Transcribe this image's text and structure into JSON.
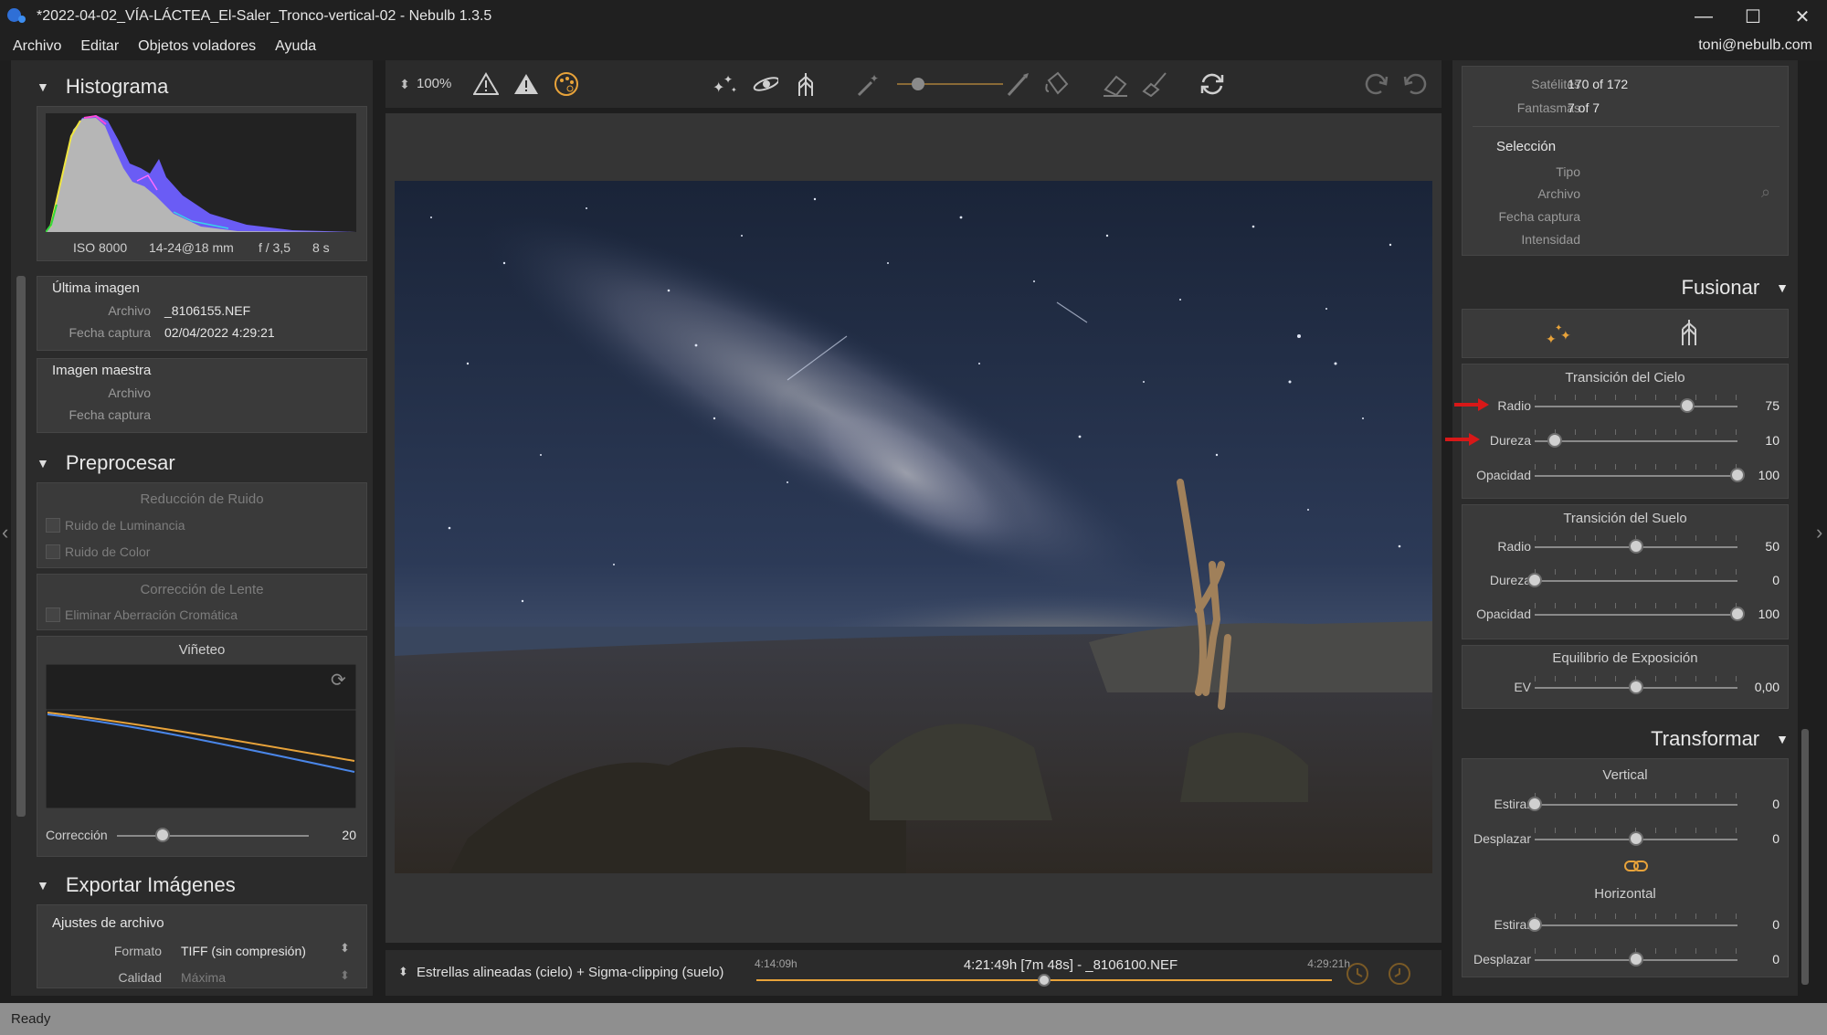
{
  "window": {
    "title": "*2022-04-02_VÍA-LÁCTEA_El-Saler_Tronco-vertical-02 - Nebulb 1.3.5",
    "minimize": "—",
    "maximize": "☐",
    "close": "✕"
  },
  "menu": {
    "items": [
      "Archivo",
      "Editar",
      "Objetos voladores",
      "Ayuda"
    ],
    "user": "toni@nebulb.com"
  },
  "histogram": {
    "title": "Histograma",
    "iso": "ISO 8000",
    "lens": "14-24@18 mm",
    "aperture": "f / 3,5",
    "exposure": "8 s"
  },
  "last_image": {
    "title": "Última imagen",
    "archivo_label": "Archivo",
    "archivo_value": "_8106155.NEF",
    "fecha_label": "Fecha captura",
    "fecha_value": "02/04/2022 4:29:21"
  },
  "master_image": {
    "title": "Imagen maestra",
    "archivo_label": "Archivo",
    "fecha_label": "Fecha captura"
  },
  "preprocess": {
    "title": "Preprocesar",
    "noise_title": "Reducción de Ruido",
    "luminance": "Ruido de Luminancia",
    "color": "Ruido de Color",
    "lens_title": "Corrección de Lente",
    "chromatic": "Eliminar Aberración Cromática",
    "vignette_title": "Viñeteo",
    "correction_label": "Corrección",
    "correction_value": "20",
    "correction_level": 0.24
  },
  "export": {
    "title": "Exportar Imágenes",
    "settings_title": "Ajustes de archivo",
    "format_label": "Formato",
    "format_value": "TIFF (sin compresión)",
    "quality_label": "Calidad",
    "quality_value": "Máxima"
  },
  "toolbar": {
    "zoom": "100%"
  },
  "bottom": {
    "mode": "Estrellas alineadas (cielo) + Sigma-clipping (suelo)",
    "time_start": "4:14:09h",
    "time_current": "4:21:49h [7m 48s] - _8106100.NEF",
    "time_end": "4:29:21h",
    "timeline_position": 0.5
  },
  "stats": {
    "satelites_label": "Satélites",
    "satelites_value": "170 of 172",
    "fantasmas_label": "Fantasmas",
    "fantasmas_value": "7 of 7"
  },
  "selection": {
    "title": "Selección",
    "tipo": "Tipo",
    "archivo": "Archivo",
    "fecha": "Fecha captura",
    "intensidad": "Intensidad"
  },
  "fusionar": {
    "title": "Fusionar",
    "sky_title": "Transición del Cielo",
    "sky": [
      {
        "label": "Radio",
        "value": "75",
        "level": 0.75
      },
      {
        "label": "Dureza",
        "value": "10",
        "level": 0.1
      },
      {
        "label": "Opacidad",
        "value": "100",
        "level": 1.0
      }
    ],
    "ground_title": "Transición del Suelo",
    "ground": [
      {
        "label": "Radio",
        "value": "50",
        "level": 0.5
      },
      {
        "label": "Dureza",
        "value": "0",
        "level": 0.0
      },
      {
        "label": "Opacidad",
        "value": "100",
        "level": 1.0
      }
    ],
    "ev_title": "Equilibrio de Exposición",
    "ev_label": "EV",
    "ev_value": "0,00",
    "ev_level": 0.5
  },
  "transformar": {
    "title": "Transformar",
    "vertical_title": "Vertical",
    "vertical": [
      {
        "label": "Estirar",
        "value": "0",
        "level": 0.0
      },
      {
        "label": "Desplazar",
        "value": "0",
        "level": 0.5
      }
    ],
    "horizontal_title": "Horizontal",
    "horizontal": [
      {
        "label": "Estirar",
        "value": "0",
        "level": 0.0
      },
      {
        "label": "Desplazar",
        "value": "0",
        "level": 0.5
      }
    ]
  },
  "status": "Ready",
  "colors": {
    "accent": "#e8a33a",
    "arrow_red": "#d81818",
    "panel": "#2b2b2b"
  }
}
